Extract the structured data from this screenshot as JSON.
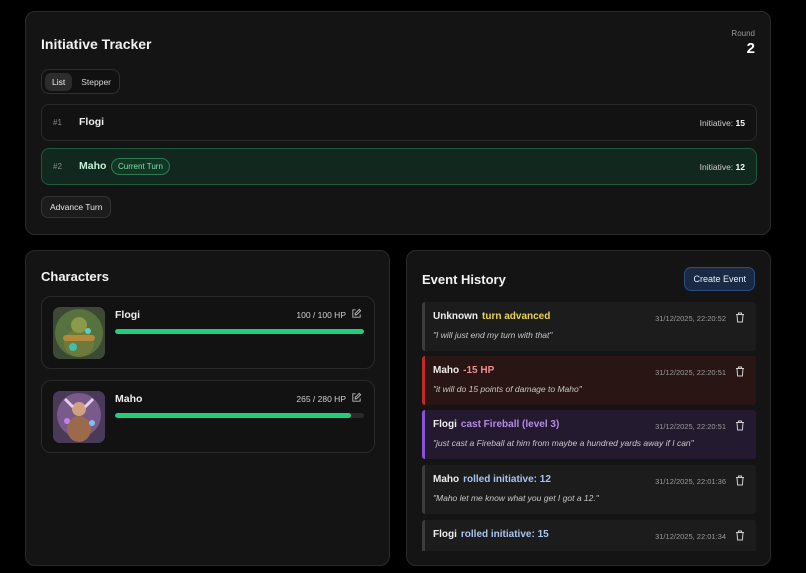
{
  "tracker": {
    "title": "Initiative Tracker",
    "round_label": "Round",
    "round_value": "2",
    "view_tabs": [
      {
        "label": "List",
        "active": true
      },
      {
        "label": "Stepper",
        "active": false
      }
    ],
    "rows": [
      {
        "num": "#1",
        "name": "Flogi",
        "initiative_label": "Initiative:",
        "initiative": "15",
        "current": false
      },
      {
        "num": "#2",
        "name": "Maho",
        "badge": "Current Turn",
        "initiative_label": "Initiative:",
        "initiative": "12",
        "current": true
      }
    ],
    "advance_label": "Advance Turn"
  },
  "characters": {
    "title": "Characters",
    "items": [
      {
        "name": "Flogi",
        "hp_text": "100 / 100 HP",
        "hp": 100,
        "max_hp": 100
      },
      {
        "name": "Maho",
        "hp_text": "265 / 280 HP",
        "hp": 265,
        "max_hp": 280
      }
    ]
  },
  "events": {
    "title": "Event History",
    "create_label": "Create Event",
    "items": [
      {
        "actor": "Unknown",
        "action": "turn advanced",
        "time": "31/12/2025, 22:20:52",
        "message": "\"I will just end my turn with that\"",
        "kind": "turn"
      },
      {
        "actor": "Maho",
        "action": "-15 HP",
        "time": "31/12/2025, 22:20:51",
        "message": "\"it will do 15 points of damage to Maho\"",
        "kind": "damage"
      },
      {
        "actor": "Flogi",
        "action": "cast Fireball (level 3)",
        "time": "31/12/2025, 22:20:51",
        "message": "\"just cast a Fireball at him from maybe a hundred yards away if I can\"",
        "kind": "spell"
      },
      {
        "actor": "Maho",
        "action": "rolled initiative: 12",
        "time": "31/12/2025, 22:01:36",
        "message": "\"Maho let me know what you get I got a 12.\"",
        "kind": "initiative"
      },
      {
        "actor": "Flogi",
        "action": "rolled initiative: 15",
        "time": "31/12/2025, 22:01:34",
        "message": "",
        "kind": "initiative"
      }
    ]
  },
  "colors": {
    "turn": "#e8d44d",
    "damage": "#ef8f8f",
    "spell": "#b68ae6",
    "initiative": "#a9c6f0",
    "hp_bar": "#1fcf7e"
  },
  "icons": {
    "edit": "pencil-square-icon",
    "delete": "trash-icon",
    "avatar": "character-portrait"
  }
}
